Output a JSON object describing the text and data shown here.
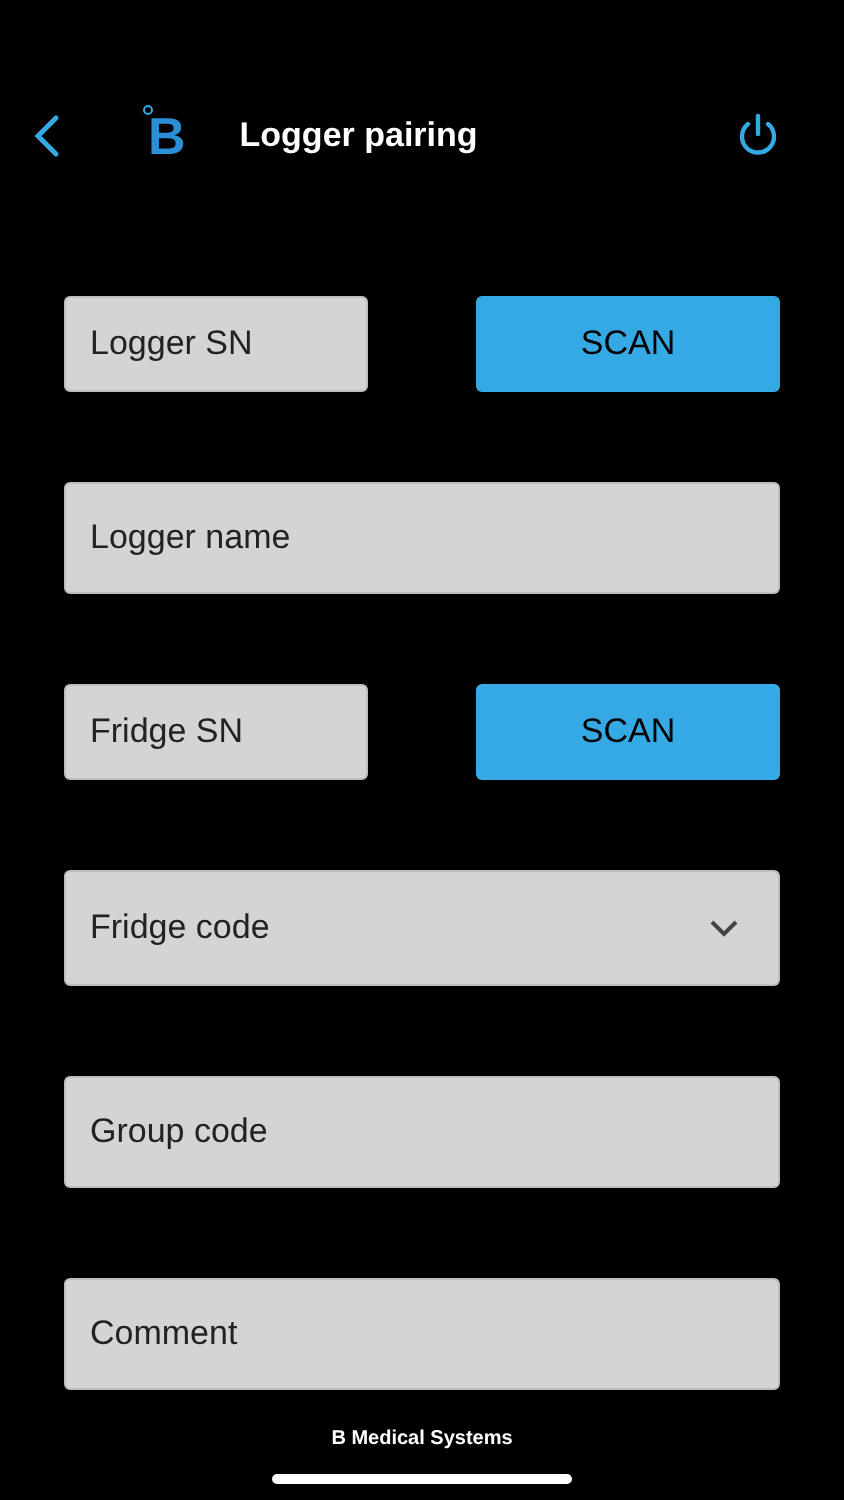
{
  "header": {
    "logo": "B",
    "title": "Logger pairing"
  },
  "rows": [
    {
      "kind": "scan",
      "placeholder": "Logger SN",
      "button": "SCAN"
    },
    {
      "kind": "text",
      "placeholder": "Logger name"
    },
    {
      "kind": "scan",
      "placeholder": "Fridge SN",
      "button": "SCAN"
    },
    {
      "kind": "dropdown",
      "placeholder": "Fridge code"
    },
    {
      "kind": "text",
      "placeholder": "Group code"
    },
    {
      "kind": "text",
      "placeholder": "Comment"
    }
  ],
  "footer": "B Medical Systems"
}
